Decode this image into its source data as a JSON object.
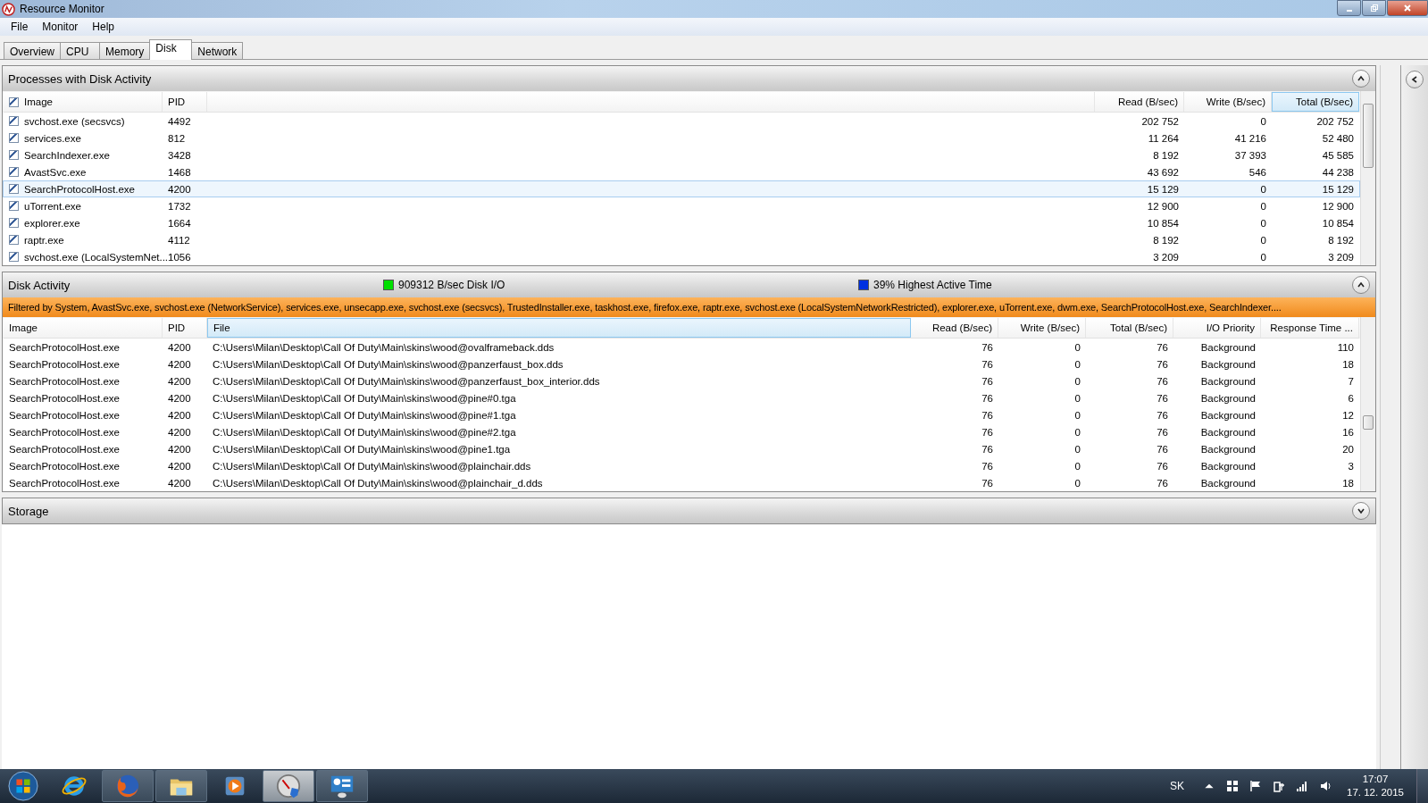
{
  "window": {
    "title": "Resource Monitor"
  },
  "menu": [
    "File",
    "Monitor",
    "Help"
  ],
  "tabs": [
    {
      "label": "Overview",
      "selected": false
    },
    {
      "label": "CPU",
      "selected": false
    },
    {
      "label": "Memory",
      "selected": false
    },
    {
      "label": "Disk",
      "selected": true
    },
    {
      "label": "Network",
      "selected": false
    }
  ],
  "processes": {
    "title": "Processes with Disk Activity",
    "expanded": true,
    "all_checked": true,
    "columns": [
      {
        "label": "Image",
        "sorted": false
      },
      {
        "label": "PID",
        "sorted": false
      },
      {
        "label": "Read (B/sec)",
        "sorted": false
      },
      {
        "label": "Write (B/sec)",
        "sorted": false
      },
      {
        "label": "Total (B/sec)",
        "sorted": true
      }
    ],
    "rows": [
      {
        "image": "svchost.exe (secsvcs)",
        "pid": "4492",
        "read": "202 752",
        "write": "0",
        "total": "202 752",
        "checked": true,
        "selected": false
      },
      {
        "image": "services.exe",
        "pid": "812",
        "read": "11 264",
        "write": "41 216",
        "total": "52 480",
        "checked": true,
        "selected": false
      },
      {
        "image": "SearchIndexer.exe",
        "pid": "3428",
        "read": "8 192",
        "write": "37 393",
        "total": "45 585",
        "checked": true,
        "selected": false
      },
      {
        "image": "AvastSvc.exe",
        "pid": "1468",
        "read": "43 692",
        "write": "546",
        "total": "44 238",
        "checked": true,
        "selected": false
      },
      {
        "image": "SearchProtocolHost.exe",
        "pid": "4200",
        "read": "15 129",
        "write": "0",
        "total": "15 129",
        "checked": true,
        "selected": true
      },
      {
        "image": "uTorrent.exe",
        "pid": "1732",
        "read": "12 900",
        "write": "0",
        "total": "12 900",
        "checked": true,
        "selected": false
      },
      {
        "image": "explorer.exe",
        "pid": "1664",
        "read": "10 854",
        "write": "0",
        "total": "10 854",
        "checked": true,
        "selected": false
      },
      {
        "image": "raptr.exe",
        "pid": "4112",
        "read": "8 192",
        "write": "0",
        "total": "8 192",
        "checked": true,
        "selected": false
      },
      {
        "image": "svchost.exe (LocalSystemNet...",
        "pid": "1056",
        "read": "3 209",
        "write": "0",
        "total": "3 209",
        "checked": true,
        "selected": false
      }
    ]
  },
  "disk_activity": {
    "title": "Disk Activity",
    "expanded": true,
    "legend": [
      {
        "label": "909312 B/sec Disk I/O",
        "color": "#00e000"
      },
      {
        "label": "39% Highest Active Time",
        "color": "#0030e0"
      }
    ],
    "filter": "Filtered by System, AvastSvc.exe, svchost.exe (NetworkService), services.exe, unsecapp.exe, svchost.exe (secsvcs), TrustedInstaller.exe, taskhost.exe, firefox.exe, raptr.exe, svchost.exe (LocalSystemNetworkRestricted), explorer.exe, uTorrent.exe, dwm.exe, SearchProtocolHost.exe, SearchIndexer....",
    "columns": [
      {
        "label": "Image",
        "sorted": false
      },
      {
        "label": "PID",
        "sorted": false
      },
      {
        "label": "File",
        "sorted": true
      },
      {
        "label": "Read (B/sec)",
        "sorted": false
      },
      {
        "label": "Write (B/sec)",
        "sorted": false
      },
      {
        "label": "Total (B/sec)",
        "sorted": false
      },
      {
        "label": "I/O Priority",
        "sorted": false
      },
      {
        "label": "Response Time ...",
        "sorted": false
      }
    ],
    "rows": [
      {
        "image": "SearchProtocolHost.exe",
        "pid": "4200",
        "file": "C:\\Users\\Milan\\Desktop\\Call Of Duty\\Main\\skins\\wood@ovalframeback.dds",
        "read": "76",
        "write": "0",
        "total": "76",
        "priority": "Background",
        "response": "110"
      },
      {
        "image": "SearchProtocolHost.exe",
        "pid": "4200",
        "file": "C:\\Users\\Milan\\Desktop\\Call Of Duty\\Main\\skins\\wood@panzerfaust_box.dds",
        "read": "76",
        "write": "0",
        "total": "76",
        "priority": "Background",
        "response": "18"
      },
      {
        "image": "SearchProtocolHost.exe",
        "pid": "4200",
        "file": "C:\\Users\\Milan\\Desktop\\Call Of Duty\\Main\\skins\\wood@panzerfaust_box_interior.dds",
        "read": "76",
        "write": "0",
        "total": "76",
        "priority": "Background",
        "response": "7"
      },
      {
        "image": "SearchProtocolHost.exe",
        "pid": "4200",
        "file": "C:\\Users\\Milan\\Desktop\\Call Of Duty\\Main\\skins\\wood@pine#0.tga",
        "read": "76",
        "write": "0",
        "total": "76",
        "priority": "Background",
        "response": "6"
      },
      {
        "image": "SearchProtocolHost.exe",
        "pid": "4200",
        "file": "C:\\Users\\Milan\\Desktop\\Call Of Duty\\Main\\skins\\wood@pine#1.tga",
        "read": "76",
        "write": "0",
        "total": "76",
        "priority": "Background",
        "response": "12"
      },
      {
        "image": "SearchProtocolHost.exe",
        "pid": "4200",
        "file": "C:\\Users\\Milan\\Desktop\\Call Of Duty\\Main\\skins\\wood@pine#2.tga",
        "read": "76",
        "write": "0",
        "total": "76",
        "priority": "Background",
        "response": "16"
      },
      {
        "image": "SearchProtocolHost.exe",
        "pid": "4200",
        "file": "C:\\Users\\Milan\\Desktop\\Call Of Duty\\Main\\skins\\wood@pine1.tga",
        "read": "76",
        "write": "0",
        "total": "76",
        "priority": "Background",
        "response": "20"
      },
      {
        "image": "SearchProtocolHost.exe",
        "pid": "4200",
        "file": "C:\\Users\\Milan\\Desktop\\Call Of Duty\\Main\\skins\\wood@plainchair.dds",
        "read": "76",
        "write": "0",
        "total": "76",
        "priority": "Background",
        "response": "3"
      },
      {
        "image": "SearchProtocolHost.exe",
        "pid": "4200",
        "file": "C:\\Users\\Milan\\Desktop\\Call Of Duty\\Main\\skins\\wood@plainchair_d.dds",
        "read": "76",
        "write": "0",
        "total": "76",
        "priority": "Background",
        "response": "18"
      }
    ]
  },
  "storage": {
    "title": "Storage",
    "expanded": false
  },
  "taskbar": {
    "apps": [
      {
        "kind": "ie",
        "running": false,
        "selected": false
      },
      {
        "kind": "firefox",
        "running": true,
        "selected": false
      },
      {
        "kind": "folder",
        "running": true,
        "selected": false
      },
      {
        "kind": "media",
        "running": false,
        "selected": false
      },
      {
        "kind": "gauge",
        "running": true,
        "selected": true
      },
      {
        "kind": "panel",
        "running": true,
        "selected": false
      }
    ],
    "language": "SK",
    "time": "17:07",
    "date": "17. 12. 2015"
  }
}
